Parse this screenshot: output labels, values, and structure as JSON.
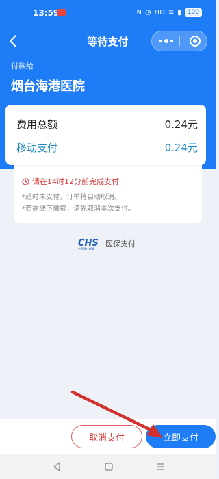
{
  "status": {
    "time": "13:59",
    "battery": "100"
  },
  "nav": {
    "title": "等待支付"
  },
  "payment": {
    "payee_label": "付款给",
    "payee_name": "烟台海港医院",
    "total_label": "费用总额",
    "total_value": "0.24元",
    "mobile_label": "移动支付",
    "mobile_value": "0.24元"
  },
  "notice": {
    "warning": "请在14时12分前完成支付",
    "line1": "*超时未支付，订单将自动取消。",
    "line2": "*若需线下缴费，请先取消本次支付。"
  },
  "branding": {
    "logo_text": "CHS",
    "logo_subtext": "中国医疗保障",
    "label": "医保支付"
  },
  "footer": {
    "cancel_label": "取消支付",
    "pay_label": "立即支付"
  },
  "colors": {
    "primary": "#1e7cf7",
    "mobile_amount": "#1e88c9",
    "warning": "#d8393a",
    "annotation": "#d0312d"
  },
  "icons": [
    "back-icon",
    "more-icon",
    "target-icon",
    "clock-icon",
    "back-triangle-icon",
    "home-square-icon",
    "menu-lines-icon"
  ]
}
